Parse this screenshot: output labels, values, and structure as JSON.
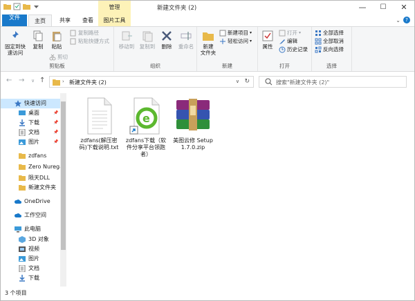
{
  "window": {
    "title": "新建文件夹 (2)",
    "context_tab": "管理",
    "minimize": "—",
    "maximize": "☐",
    "close": "✕"
  },
  "tabs": {
    "file": "文件",
    "home": "主页",
    "share": "共享",
    "view": "查看",
    "picture_tools": "图片工具"
  },
  "ribbon": {
    "clipboard": {
      "label": "剪贴板",
      "pin": "固定到快\n速访问",
      "copy": "复制",
      "paste": "粘贴",
      "copy_path": "复制路径",
      "paste_shortcut": "粘贴快捷方式",
      "cut": "剪切"
    },
    "organize": {
      "label": "组织",
      "move_to": "移动到",
      "copy_to": "复制到",
      "delete": "删除",
      "rename": "重命名"
    },
    "new": {
      "label": "新建",
      "new_folder": "新建\n文件夹",
      "new_item": "新建项目",
      "easy_access": "轻松访问"
    },
    "open": {
      "label": "打开",
      "properties": "属性",
      "open": "打开",
      "edit": "编辑",
      "history": "历史记录"
    },
    "select": {
      "label": "选择",
      "select_all": "全部选择",
      "select_none": "全部取消",
      "invert": "反向选择"
    }
  },
  "address": {
    "path": "新建文件夹 (2)",
    "search_placeholder": "搜索\"新建文件夹 (2)\""
  },
  "nav": {
    "quick_access": "快速访问",
    "desktop": "桌面",
    "downloads": "下载",
    "documents": "文档",
    "pictures": "图片",
    "f1": "zdfans",
    "f2": "Zero Nurega",
    "f3": "陨天DLL",
    "f4": "新建文件夹",
    "onedrive": "OneDrive",
    "workspace": "工作空间",
    "this_pc": "此电脑",
    "objects3d": "3D 对象",
    "videos": "视频",
    "pc_pictures": "图片",
    "pc_documents": "文档",
    "pc_downloads": "下载"
  },
  "files": [
    {
      "name": "zdfans(解压密码)下载说明.txt",
      "icon": "text-file-icon"
    },
    {
      "name": "zdfans下载（软件分享平台领跑者）",
      "icon": "shortcut-icon"
    },
    {
      "name": "美图云修 Setup 1.7.0.zip",
      "icon": "winrar-archive-icon"
    }
  ],
  "status": {
    "count": "3 个项目"
  },
  "colors": {
    "accent": "#1979ca",
    "context_tab": "#fdf2b8",
    "selection": "#cce8ff"
  }
}
